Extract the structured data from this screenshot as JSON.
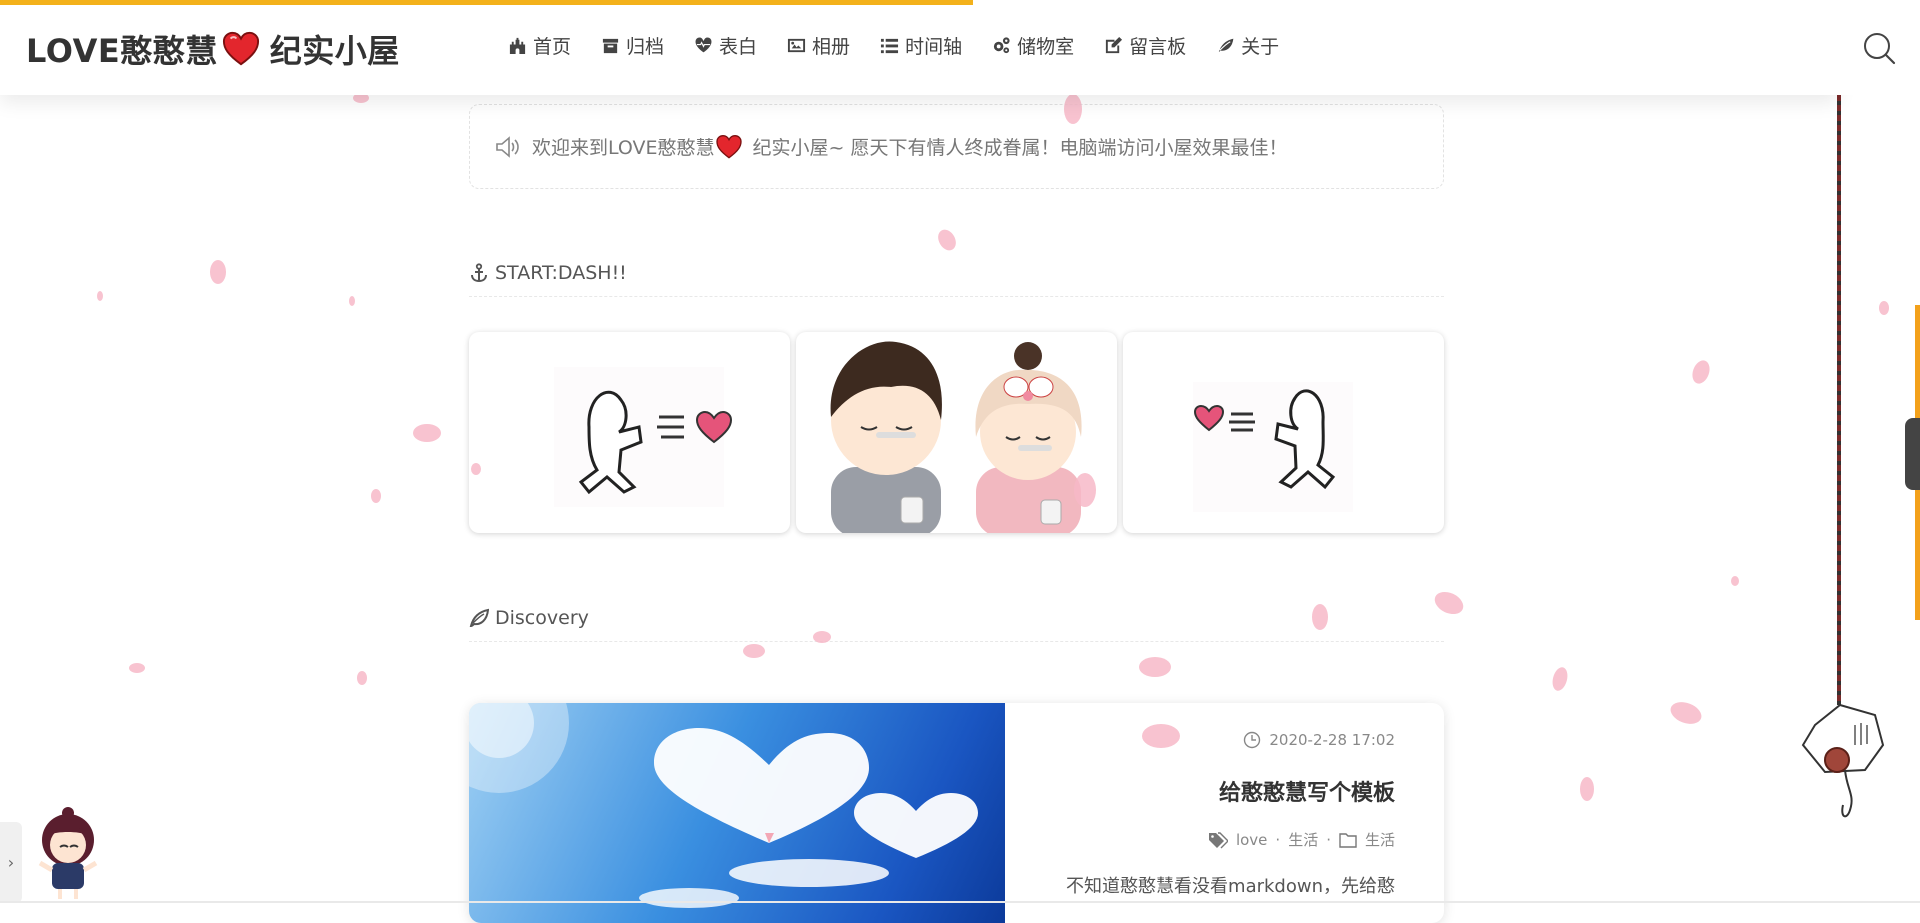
{
  "progress_fraction": 0.507,
  "header": {
    "site_title": "LOVE憨憨慧",
    "site_title_suffix": "纪实小屋",
    "nav": [
      {
        "label": "首页",
        "icon": "castle-icon"
      },
      {
        "label": "归档",
        "icon": "archive-icon"
      },
      {
        "label": "表白",
        "icon": "heartbeat-icon"
      },
      {
        "label": "相册",
        "icon": "image-icon"
      },
      {
        "label": "时间轴",
        "icon": "list-icon"
      },
      {
        "label": "储物室",
        "icon": "gears-icon"
      },
      {
        "label": "留言板",
        "icon": "edit-icon"
      },
      {
        "label": "关于",
        "icon": "leaf-icon"
      }
    ]
  },
  "notice": {
    "prefix": "欢迎来到LOVE憨憨慧",
    "suffix": "纪实小屋~ 愿天下有情人终成眷属！电脑端访问小屋效果最佳！"
  },
  "sections": {
    "start_dash": "START:DASH!!",
    "discovery": "Discovery"
  },
  "post": {
    "date": "2020-2-28 17:02",
    "title": "给憨憨慧写个模板",
    "tags": [
      "love",
      "生活"
    ],
    "category": "生活",
    "excerpt": "不知道憨憨慧看没看markdown，先给憨"
  },
  "colors": {
    "accent": "#f3b11b",
    "heart": "#e3262d",
    "petal": "#f7b9c8"
  }
}
